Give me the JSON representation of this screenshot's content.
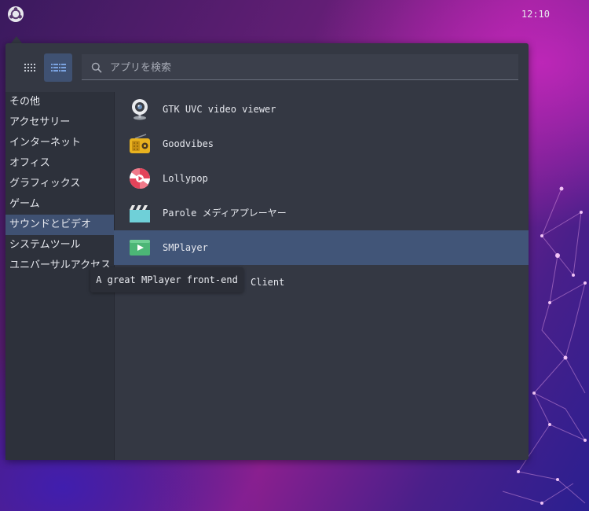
{
  "topbar": {
    "clock": "12:10",
    "logo_icon": "ubuntu-budgie-logo-icon"
  },
  "menu": {
    "search": {
      "placeholder": "アプリを検索",
      "value": ""
    },
    "view_buttons": [
      {
        "name": "grid-view-icon",
        "active": false
      },
      {
        "name": "list-view-icon",
        "active": true
      }
    ],
    "categories": [
      {
        "label": "その他"
      },
      {
        "label": "アクセサリー"
      },
      {
        "label": "インターネット"
      },
      {
        "label": "オフィス"
      },
      {
        "label": "グラフィックス"
      },
      {
        "label": "ゲーム"
      },
      {
        "label": "サウンドとビデオ",
        "active": true
      },
      {
        "label": "システムツール"
      },
      {
        "label": "ユニバーサルアクセス"
      }
    ],
    "apps": [
      {
        "label": "GTK UVC video viewer",
        "icon": "webcam-icon"
      },
      {
        "label": "Goodvibes",
        "icon": "radio-icon"
      },
      {
        "label": "Lollypop",
        "icon": "lollypop-icon"
      },
      {
        "label": "Parole メディアプレーヤー",
        "icon": "clapperboard-icon"
      },
      {
        "label": "SMPlayer",
        "icon": "play-icon",
        "active": true
      },
      {
        "label": "Client",
        "icon": ""
      }
    ],
    "tooltip": "A great MPlayer front-end"
  },
  "colors": {
    "accent": "#415578",
    "panel": "#343843",
    "sidebar": "#2d313b"
  }
}
